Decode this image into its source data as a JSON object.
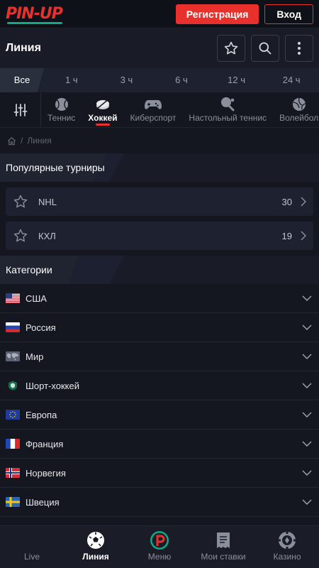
{
  "header": {
    "logo_text": "PIN-UP",
    "register_label": "Регистрация",
    "login_label": "Вход"
  },
  "titlebar": {
    "title": "Линия",
    "icons": [
      "star-icon",
      "search-icon",
      "more-vertical-icon"
    ]
  },
  "time_tabs": [
    "Все",
    "1 ч",
    "3 ч",
    "6 ч",
    "12 ч",
    "24 ч"
  ],
  "sports": [
    {
      "label": "Теннис",
      "icon": "tennis-ball-icon",
      "active": false
    },
    {
      "label": "Хоккей",
      "icon": "hockey-puck-icon",
      "active": true
    },
    {
      "label": "Киберспорт",
      "icon": "gamepad-icon",
      "active": false
    },
    {
      "label": "Настольный теннис",
      "icon": "ping-pong-icon",
      "active": false
    },
    {
      "label": "Волейбол",
      "icon": "volleyball-icon",
      "active": false
    }
  ],
  "breadcrumb": {
    "separator": "/",
    "current": "Линия"
  },
  "popular": {
    "heading": "Популярные турниры",
    "items": [
      {
        "name": "NHL",
        "count": "30"
      },
      {
        "name": "КХЛ",
        "count": "19"
      }
    ]
  },
  "categories": {
    "heading": "Категории",
    "items": [
      {
        "name": "США",
        "flag": "us"
      },
      {
        "name": "Россия",
        "flag": "ru"
      },
      {
        "name": "Мир",
        "flag": "world"
      },
      {
        "name": "Шорт-хоккей",
        "flag": "short"
      },
      {
        "name": "Европа",
        "flag": "eu"
      },
      {
        "name": "Франция",
        "flag": "fr"
      },
      {
        "name": "Норвегия",
        "flag": "no"
      },
      {
        "name": "Швеция",
        "flag": "se"
      }
    ]
  },
  "bottom_nav": [
    {
      "label": "Live",
      "icon": "live-icon",
      "active": false
    },
    {
      "label": "Линия",
      "icon": "soccer-ball-icon",
      "active": true
    },
    {
      "label": "Меню",
      "icon": "pinup-logo-icon",
      "active": false
    },
    {
      "label": "Мои ставки",
      "icon": "receipt-icon",
      "active": false
    },
    {
      "label": "Казино",
      "icon": "casino-chip-icon",
      "active": false
    }
  ],
  "colors": {
    "accent": "#e8312c",
    "brand_green": "#14a88a",
    "background": "#141720"
  }
}
